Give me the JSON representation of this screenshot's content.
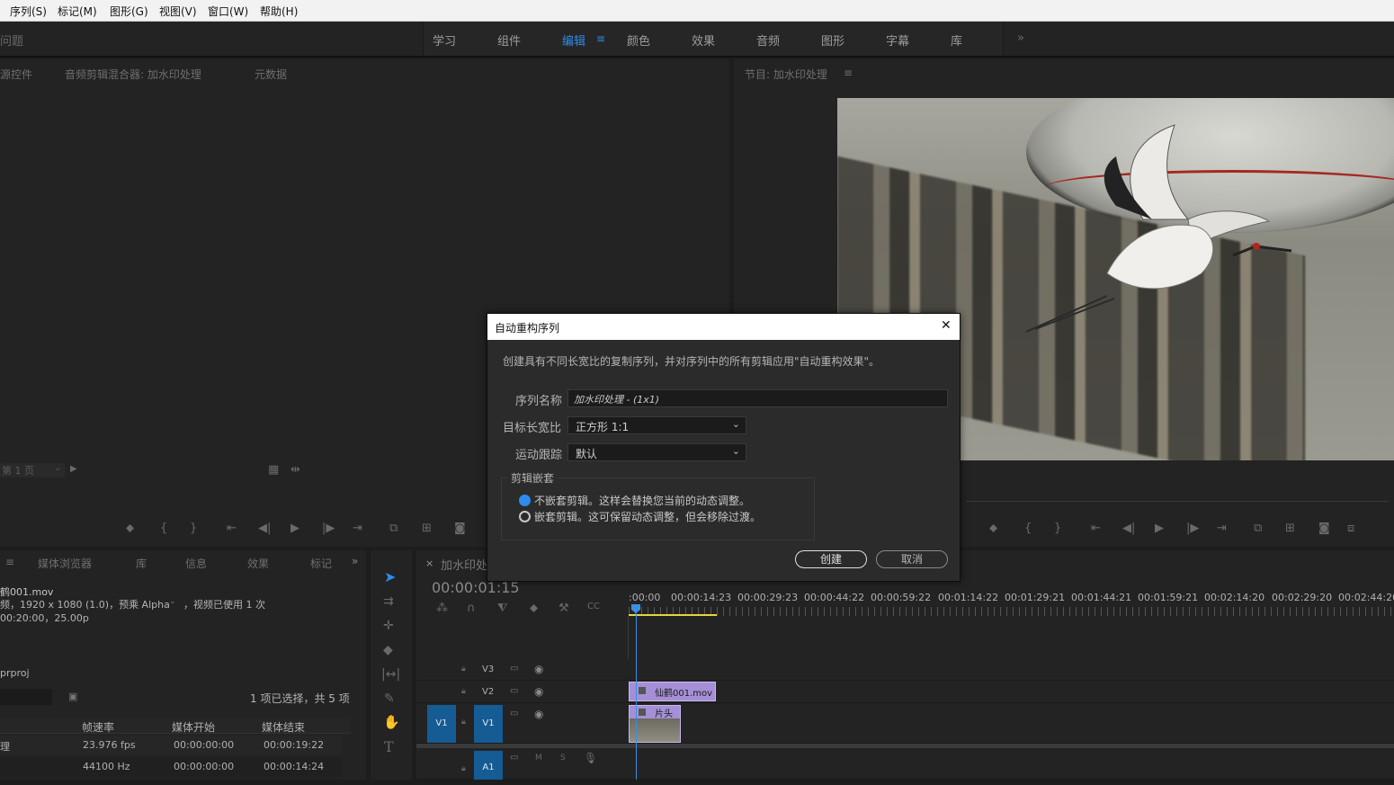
{
  "menubar": {
    "items": [
      "序列(S)",
      "标记(M)",
      "图形(G)",
      "视图(V)",
      "窗口(W)",
      "帮助(H)"
    ]
  },
  "workspace": {
    "left_label": "问题",
    "tabs": [
      "学习",
      "组件",
      "编辑",
      "颜色",
      "效果",
      "音频",
      "图形",
      "字幕",
      "库"
    ],
    "active_index": 2,
    "overflow": "»"
  },
  "source_panel": {
    "tabs": [
      "源控件",
      "音频剪辑混合器: 加水印处理",
      "元数据"
    ],
    "page_select": "第 1 页"
  },
  "program_panel": {
    "title": "节目: 加水印处理",
    "menu": "≡"
  },
  "project_panel": {
    "tabs": [
      "媒体浏览器",
      "库",
      "信息",
      "效果",
      "标记"
    ],
    "clip_name": "鹤001.mov",
    "clip_info_line1": "频，1920 x 1080 (1.0)，预乘 Alpha",
    "clip_info_line1b": "，视频已使用 1 次",
    "clip_info_line2": "00:20:00，25.00p",
    "project_file": "prproj",
    "selection_count": "1 项已选择，共 5 项",
    "columns": [
      "帧速率",
      "媒体开始",
      "媒体结束"
    ],
    "rows": [
      {
        "name": "理",
        "fps": "23.976 fps",
        "start": "00:00:00:00",
        "end": "00:00:19:22"
      },
      {
        "name": "",
        "fps": "44100 Hz",
        "start": "00:00:00:00",
        "end": "00:00:14:24"
      }
    ]
  },
  "timeline": {
    "tab": "加水印处",
    "timecode": "00:00:01:15",
    "ruler": [
      ":00:00",
      "00:00:14:23",
      "00:00:29:23",
      "00:00:44:22",
      "00:00:59:22",
      "00:01:14:22",
      "00:01:29:21",
      "00:01:44:21",
      "00:01:59:21",
      "00:02:14:20",
      "00:02:29:20",
      "00:02:44:20"
    ],
    "tracks": {
      "v3": "V3",
      "v2": "V2",
      "v1": "V1",
      "v1_src": "V1",
      "a1": "A1"
    },
    "clips": {
      "v2_clip": "仙鹤001.mov",
      "v1_clip": "片头"
    },
    "audio_ms": [
      "M",
      "S"
    ]
  },
  "dialog": {
    "title": "自动重构序列",
    "close": "✕",
    "description": "创建具有不同长宽比的复制序列，并对序列中的所有剪辑应用\"自动重构效果\"。",
    "sequence_name_label": "序列名称",
    "sequence_name_value": "加水印处理 - (1x1)",
    "aspect_label": "目标长宽比",
    "aspect_value": "正方形 1:1",
    "tracking_label": "运动跟踪",
    "tracking_value": "默认",
    "nesting_title": "剪辑嵌套",
    "option1": "不嵌套剪辑。这样会替换您当前的动态调整。",
    "option2": "嵌套剪辑。这可保留动态调整，但会移除过渡。",
    "selected_option": 1,
    "create_label": "创建",
    "cancel_label": "取消"
  },
  "colors": {
    "accent": "#2d8ceb",
    "track_blue": "#155b94",
    "clip_purple": "#a58fd6",
    "playhead": "#3c8fe0",
    "work_area": "#e6d43c"
  }
}
